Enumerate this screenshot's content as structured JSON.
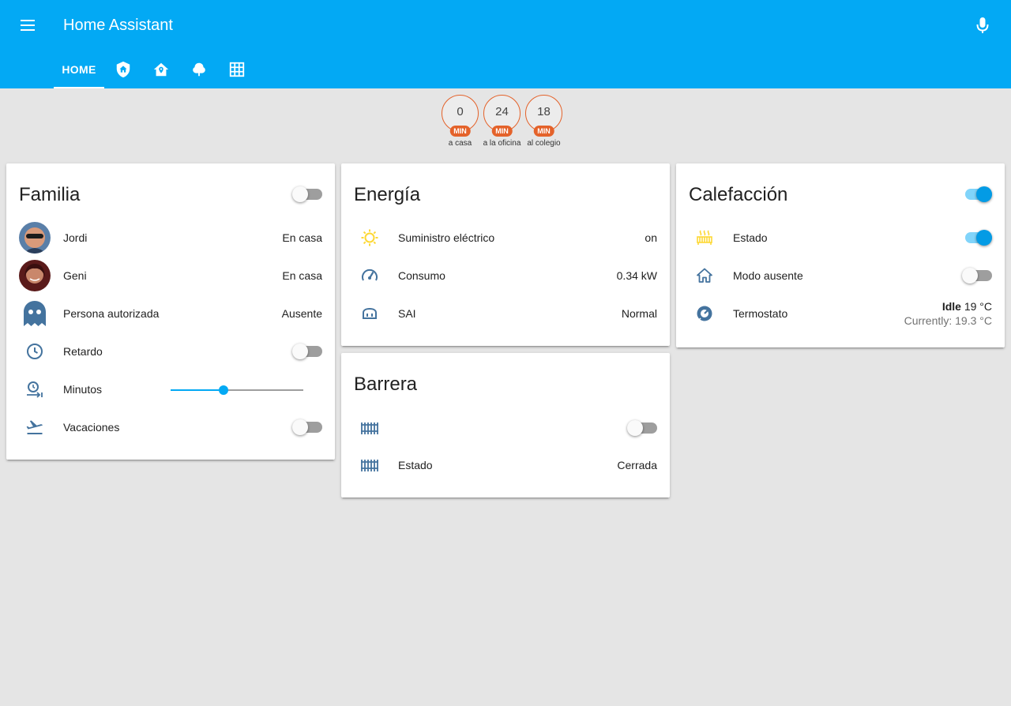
{
  "app": {
    "title": "Home Assistant"
  },
  "colors": {
    "primary": "#03a9f4",
    "icon": "#44739e",
    "icon_active": "#fdd835",
    "badge": "#e4622a",
    "toggle_on": "#039be5"
  },
  "tabs": [
    {
      "label": "HOME",
      "active": true
    },
    {
      "icon": "shield-home-icon"
    },
    {
      "icon": "home-map-marker-icon"
    },
    {
      "icon": "tree-icon"
    },
    {
      "icon": "grid-icon"
    }
  ],
  "badges": [
    {
      "value": "0",
      "unit": "MIN",
      "label": "a casa"
    },
    {
      "value": "24",
      "unit": "MIN",
      "label": "a la oficina"
    },
    {
      "value": "18",
      "unit": "MIN",
      "label": "al colegio"
    }
  ],
  "familia": {
    "title": "Familia",
    "header_toggle": false,
    "rows": [
      {
        "name": "Jordi",
        "state": "En casa"
      },
      {
        "name": "Geni",
        "state": "En casa"
      },
      {
        "name": "Persona autorizada",
        "state": "Ausente"
      },
      {
        "name": "Retardo",
        "toggle": false
      },
      {
        "name": "Minutos",
        "slider_fraction": 0.4
      },
      {
        "name": "Vacaciones",
        "toggle": false
      }
    ]
  },
  "energia": {
    "title": "Energía",
    "rows": [
      {
        "name": "Suministro eléctrico",
        "state": "on"
      },
      {
        "name": "Consumo",
        "state": "0.34 kW"
      },
      {
        "name": "SAI",
        "state": "Normal"
      }
    ]
  },
  "barrera": {
    "title": "Barrera",
    "rows": [
      {
        "name": "",
        "toggle": false
      },
      {
        "name": "Estado",
        "state": "Cerrada"
      }
    ]
  },
  "calefaccion": {
    "title": "Calefacción",
    "header_toggle": true,
    "rows": [
      {
        "name": "Estado",
        "toggle": true
      },
      {
        "name": "Modo ausente",
        "toggle": false
      },
      {
        "name": "Termostato",
        "state_strong": "Idle",
        "state_temp": "19 °C",
        "state_current": "Currently: 19.3 °C"
      }
    ]
  }
}
